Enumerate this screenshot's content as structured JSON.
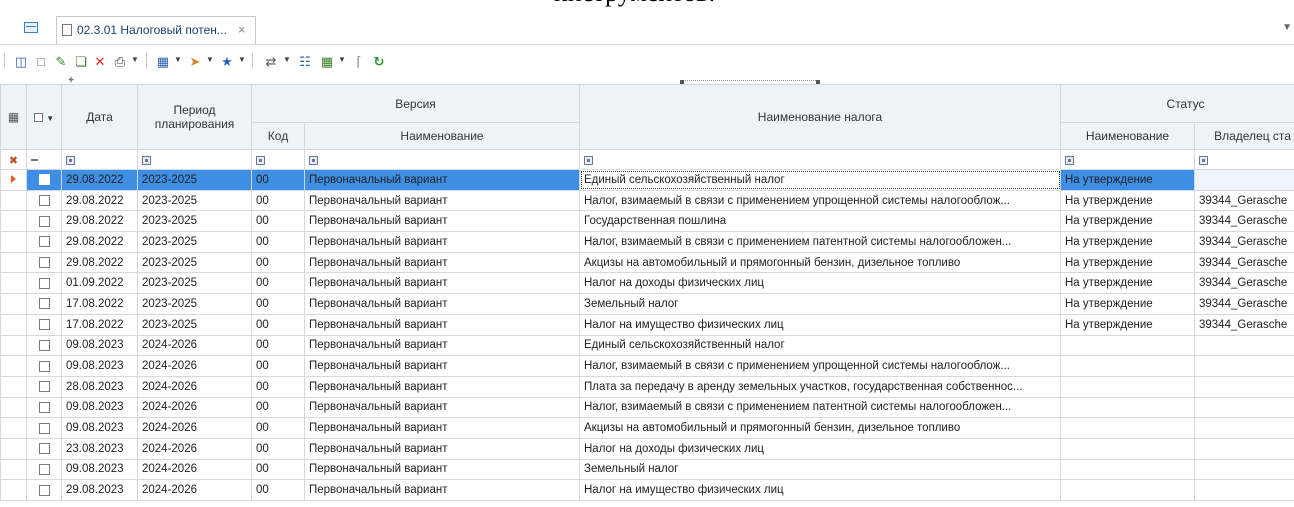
{
  "top_fragment": "инструментов.",
  "tabs": [
    {
      "label": "02.3.01 Налоговый потен...",
      "close": "×"
    }
  ],
  "toolbar": {
    "icons": [
      "database-icon",
      "new-document-icon",
      "edit-icon",
      "copy-icon",
      "delete-icon",
      "print-icon",
      "export-icon",
      "import-icon",
      "filter-icon",
      "link-icon",
      "report-icon",
      "calendar-icon",
      "attachment-icon",
      "refresh-icon"
    ]
  },
  "grid": {
    "headers": {
      "date": "Дата",
      "period": "Период планирования",
      "version": "Версия",
      "version_code": "Код",
      "version_name": "Наименование",
      "tax_name": "Наименование налога",
      "status": "Статус",
      "status_name": "Наименование",
      "status_owner": "Владелец ста"
    },
    "rows": [
      {
        "date": "29.08.2022",
        "period": "2023-2025",
        "code": "00",
        "version": "Первоначальный вариант",
        "tax": "Единый сельскохозяйственный налог",
        "status": "На утверждение",
        "owner": "",
        "selected": true
      },
      {
        "date": "29.08.2022",
        "period": "2023-2025",
        "code": "00",
        "version": "Первоначальный вариант",
        "tax": "Налог, взимаемый в связи с применением упрощенной системы налогооблож...",
        "status": "На утверждение",
        "owner": "39344_Gerasche"
      },
      {
        "date": "29.08.2022",
        "period": "2023-2025",
        "code": "00",
        "version": "Первоначальный вариант",
        "tax": "Государственная пошлина",
        "status": "На утверждение",
        "owner": "39344_Gerasche"
      },
      {
        "date": "29.08.2022",
        "period": "2023-2025",
        "code": "00",
        "version": "Первоначальный вариант",
        "tax": "Налог, взимаемый в связи с применением патентной системы налогообложен...",
        "status": "На утверждение",
        "owner": "39344_Gerasche"
      },
      {
        "date": "29.08.2022",
        "period": "2023-2025",
        "code": "00",
        "version": "Первоначальный вариант",
        "tax": "Акцизы на автомобильный и прямогонный бензин, дизельное топливо",
        "status": "На утверждение",
        "owner": "39344_Gerasche"
      },
      {
        "date": "01.09.2022",
        "period": "2023-2025",
        "code": "00",
        "version": "Первоначальный вариант",
        "tax": "Налог на доходы физических лиц",
        "status": "На утверждение",
        "owner": "39344_Gerasche"
      },
      {
        "date": "17.08.2022",
        "period": "2023-2025",
        "code": "00",
        "version": "Первоначальный вариант",
        "tax": "Земельный налог",
        "status": "На утверждение",
        "owner": "39344_Gerasche"
      },
      {
        "date": "17.08.2022",
        "period": "2023-2025",
        "code": "00",
        "version": "Первоначальный вариант",
        "tax": "Налог на имущество физических лиц",
        "status": "На утверждение",
        "owner": "39344_Gerasche"
      },
      {
        "date": "09.08.2023",
        "period": "2024-2026",
        "code": "00",
        "version": "Первоначальный вариант",
        "tax": "Единый сельскохозяйственный налог",
        "status": "",
        "owner": ""
      },
      {
        "date": "09.08.2023",
        "period": "2024-2026",
        "code": "00",
        "version": "Первоначальный вариант",
        "tax": "Налог, взимаемый в связи с применением упрощенной системы налогооблож...",
        "status": "",
        "owner": ""
      },
      {
        "date": "28.08.2023",
        "period": "2024-2026",
        "code": "00",
        "version": "Первоначальный вариант",
        "tax": "Плата за передачу в аренду земельных участков, государственная собственнос...",
        "status": "",
        "owner": ""
      },
      {
        "date": "09.08.2023",
        "period": "2024-2026",
        "code": "00",
        "version": "Первоначальный вариант",
        "tax": "Налог, взимаемый в связи с применением патентной системы налогообложен...",
        "status": "",
        "owner": ""
      },
      {
        "date": "09.08.2023",
        "period": "2024-2026",
        "code": "00",
        "version": "Первоначальный вариант",
        "tax": "Акцизы на автомобильный и прямогонный бензин, дизельное топливо",
        "status": "",
        "owner": ""
      },
      {
        "date": "23.08.2023",
        "period": "2024-2026",
        "code": "00",
        "version": "Первоначальный вариант",
        "tax": "Налог на доходы физических лиц",
        "status": "",
        "owner": ""
      },
      {
        "date": "09.08.2023",
        "period": "2024-2026",
        "code": "00",
        "version": "Первоначальный вариант",
        "tax": "Земельный налог",
        "status": "",
        "owner": ""
      },
      {
        "date": "29.08.2023",
        "period": "2024-2026",
        "code": "00",
        "version": "Первоначальный вариант",
        "tax": "Налог на имущество физических лиц",
        "status": "",
        "owner": ""
      }
    ]
  }
}
